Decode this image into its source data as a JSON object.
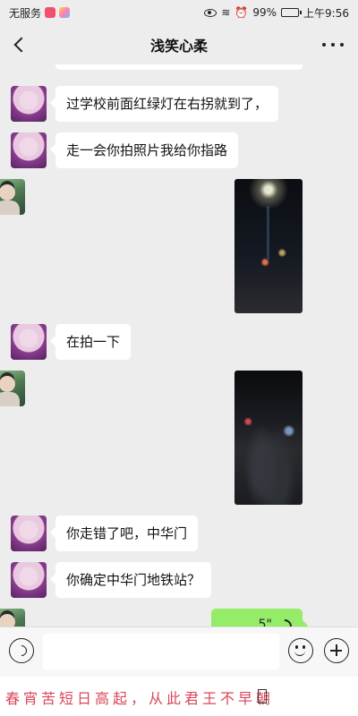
{
  "status_bar": {
    "carrier": "无服务",
    "battery": "99%",
    "battery_level": 0.99,
    "time": "上午9:56"
  },
  "header": {
    "title": "浅笑心柔"
  },
  "messages": [
    {
      "sender": "contact",
      "type": "text",
      "text": "过学校前面红绿灯在右拐就到了，"
    },
    {
      "sender": "contact",
      "type": "text",
      "text": "走一会你拍照片我给你指路"
    },
    {
      "sender": "me",
      "type": "image",
      "image": "night-street-photo"
    },
    {
      "sender": "contact",
      "type": "text",
      "text": "在拍一下"
    },
    {
      "sender": "me",
      "type": "image",
      "image": "night-street-photo-2"
    },
    {
      "sender": "contact",
      "type": "text",
      "text": "你走错了吧，中华门"
    },
    {
      "sender": "contact",
      "type": "text",
      "text": "你确定中华门地铁站？"
    },
    {
      "sender": "me",
      "type": "voice",
      "duration": "5\""
    }
  ],
  "input_bar": {
    "placeholder": ""
  },
  "banner": {
    "text": "春宵苦短日高起，从此君王不早朝"
  },
  "colors": {
    "background": "#ededed",
    "voice_bubble": "#95ec69",
    "banner_text": "#d9465a"
  }
}
